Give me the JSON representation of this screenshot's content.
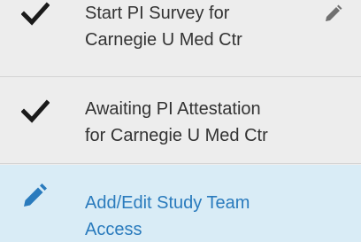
{
  "steps": [
    {
      "status": "completed",
      "icon": "check-icon",
      "lines": [
        "Start PI Survey for",
        "Carnegie U Med Ctr"
      ],
      "editable": true,
      "edit_icon": "pencil-icon"
    },
    {
      "status": "completed",
      "icon": "check-icon",
      "lines": [
        "Awaiting PI Attestation",
        "for Carnegie U Med Ctr"
      ]
    },
    {
      "status": "active",
      "icon": "pencil-icon",
      "lines": [
        "Add/Edit Study Team",
        "Access"
      ]
    }
  ],
  "colors": {
    "background": "#ededed",
    "active_background": "#d9ecf6",
    "active_text": "#2a7bbd",
    "text": "#333333",
    "divider": "#d4d4d4",
    "muted_icon": "#707070"
  }
}
